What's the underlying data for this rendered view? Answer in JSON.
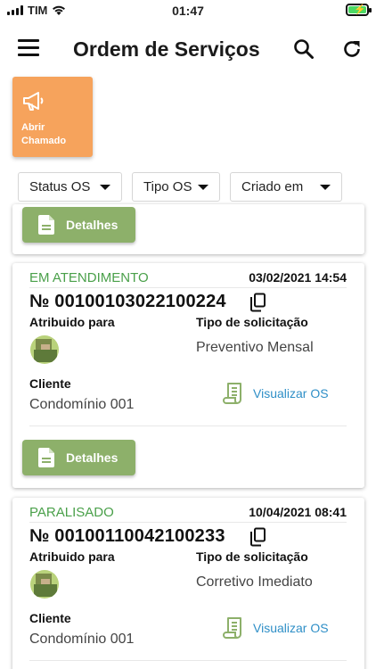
{
  "statusbar": {
    "carrier": "TIM",
    "time": "01:47"
  },
  "header": {
    "title": "Ordem de Serviços"
  },
  "open_ticket": {
    "label_line1": "Abrir",
    "label_line2": "Chamado"
  },
  "filters": [
    "Status OS",
    "Tipo OS",
    "Criado em"
  ],
  "details_label": "Detalhes",
  "labels": {
    "assigned_to": "Atribuido para",
    "request_type": "Tipo de solicitação",
    "client": "Cliente",
    "view_os": "Visualizar OS"
  },
  "cards": [
    {
      "status": "EM ATENDIMENTO",
      "datetime": "03/02/2021 14:54",
      "number": "№ 00100103022100224",
      "request_type": "Preventivo Mensal",
      "client": "Condomínio 001"
    },
    {
      "status": "PARALISADO",
      "datetime": "10/04/2021 08:41",
      "number": "№ 00100110042100233",
      "request_type": "Corretivo Imediato",
      "client": "Condomínio 001"
    }
  ],
  "colors": {
    "accent_orange": "#f6a35c",
    "details_green": "#8db06a",
    "status_green": "#4aa04a",
    "link_blue": "#2f8fc7"
  }
}
